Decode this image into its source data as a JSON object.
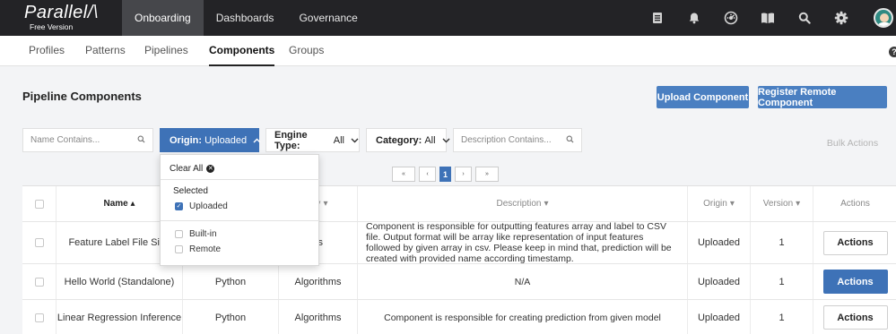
{
  "app": {
    "name": "Parallel/\\",
    "edition": "Free Version"
  },
  "topnav": [
    {
      "label": "Onboarding",
      "active": true
    },
    {
      "label": "Dashboards",
      "active": false
    },
    {
      "label": "Governance",
      "active": false
    }
  ],
  "top_icons": [
    "document-icon",
    "bell-icon",
    "dashboard-icon",
    "book-icon",
    "search-icon",
    "gear-icon",
    "avatar"
  ],
  "subnav": [
    "Profiles",
    "Patterns",
    "Pipelines",
    "Components",
    "Groups"
  ],
  "subnav_active": "Components",
  "help_glyph": "?",
  "page_title": "Pipeline Components",
  "buttons": {
    "upload": "Upload Component",
    "register": "Register Remote Component",
    "bulk": "Bulk Actions"
  },
  "filters": {
    "name_placeholder": "Name Contains...",
    "origin_label": "Origin:",
    "origin_value": "Uploaded",
    "engine_label": "Engine Type:",
    "engine_value": "All",
    "category_label": "Category:",
    "category_value": "All",
    "description_placeholder": "Description Contains..."
  },
  "pagination": {
    "first": "«",
    "prev": "‹",
    "current": "1",
    "next": "›",
    "last": "»"
  },
  "origin_dropdown": {
    "clear": "Clear All",
    "selected_heading": "Selected",
    "selected": [
      {
        "label": "Uploaded",
        "checked": true
      }
    ],
    "options": [
      {
        "label": "Built-in",
        "checked": false
      },
      {
        "label": "Remote",
        "checked": false
      }
    ]
  },
  "table": {
    "headers": {
      "name": "Name ▴",
      "engine": "",
      "category": "ory",
      "description": "Description",
      "origin": "Origin",
      "version": "Version",
      "actions": "Actions"
    },
    "sort_glyph": "▾",
    "rows": [
      {
        "name": "Feature Label File Sink",
        "engine": "",
        "category": "ks",
        "description": "Component is responsible for outputting features array and label to CSV file. Output format will be array like representation of input features followed by given array in csv. Please keep in mind that, prediction will be created with provided name according timestamp.",
        "origin": "Uploaded",
        "version": "1",
        "action": "Actions",
        "action_highlight": false
      },
      {
        "name": "Hello World (Standalone)",
        "engine": "Python",
        "category": "Algorithms",
        "description": "N/A",
        "origin": "Uploaded",
        "version": "1",
        "action": "Actions",
        "action_highlight": true
      },
      {
        "name": "Linear Regression Inference",
        "engine": "Python",
        "category": "Algorithms",
        "description": "Component is responsible for creating prediction from given model",
        "origin": "Uploaded",
        "version": "1",
        "action": "Actions",
        "action_highlight": false
      }
    ]
  },
  "colors": {
    "topbar": "#232326",
    "accent": "#3e72b7",
    "button": "#4a7fc1"
  }
}
